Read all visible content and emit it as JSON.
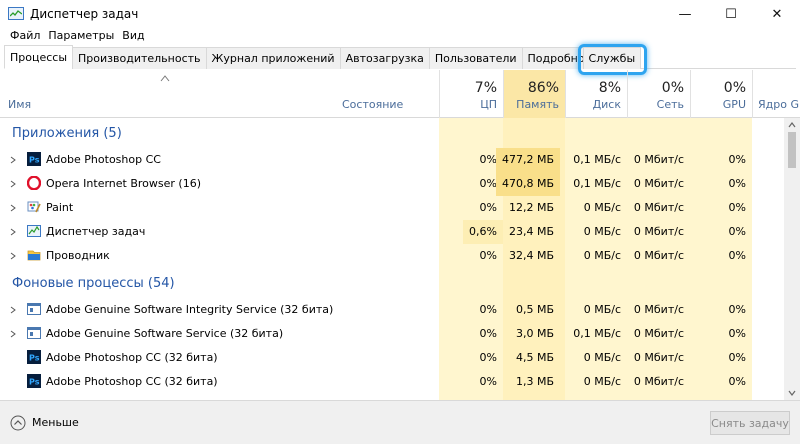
{
  "window": {
    "title": "Диспетчер задач",
    "minimize": "—",
    "maximize": "☐",
    "close": "✕"
  },
  "menu": [
    "Файл",
    "Параметры",
    "Вид"
  ],
  "tabs": [
    {
      "label": "Процессы",
      "active": true
    },
    {
      "label": "Производительность"
    },
    {
      "label": "Журнал приложений"
    },
    {
      "label": "Автозагрузка"
    },
    {
      "label": "Пользователи"
    },
    {
      "label": "Подробности"
    },
    {
      "label": "Службы",
      "highlighted": true
    }
  ],
  "columns": {
    "name": "Имя",
    "state": "Состояние",
    "cpu": {
      "pct": "7%",
      "label": "ЦП"
    },
    "mem": {
      "pct": "86%",
      "label": "Память"
    },
    "disk": {
      "pct": "8%",
      "label": "Диск"
    },
    "net": {
      "pct": "0%",
      "label": "Сеть"
    },
    "gpu": {
      "pct": "0%",
      "label": "GPU"
    },
    "gpu_engine": "Ядро GPU"
  },
  "groups": {
    "apps": "Приложения (5)",
    "background": "Фоновые процессы (54)"
  },
  "apps": [
    {
      "name": "Adobe Photoshop CC",
      "icon": "photoshop-icon",
      "cpu": "0%",
      "mem": "477,2 МБ",
      "disk": "0,1 МБ/с",
      "net": "0 Мбит/с",
      "gpu": "0%"
    },
    {
      "name": "Opera Internet Browser (16)",
      "icon": "opera-icon",
      "cpu": "0%",
      "mem": "470,8 МБ",
      "disk": "0,1 МБ/с",
      "net": "0 Мбит/с",
      "gpu": "0%"
    },
    {
      "name": "Paint",
      "icon": "paint-icon",
      "cpu": "0%",
      "mem": "12,2 МБ",
      "disk": "0 МБ/с",
      "net": "0 Мбит/с",
      "gpu": "0%"
    },
    {
      "name": "Диспетчер задач",
      "icon": "taskmgr-icon",
      "cpu": "0,6%",
      "mem": "23,4 МБ",
      "disk": "0 МБ/с",
      "net": "0 Мбит/с",
      "gpu": "0%"
    },
    {
      "name": "Проводник",
      "icon": "folder-icon",
      "cpu": "0%",
      "mem": "32,4 МБ",
      "disk": "0 МБ/с",
      "net": "0 Мбит/с",
      "gpu": "0%"
    }
  ],
  "background": [
    {
      "name": "Adobe Genuine Software Integrity Service (32 бита)",
      "icon": "service-icon",
      "expand": true,
      "cpu": "0%",
      "mem": "0,5 МБ",
      "disk": "0 МБ/с",
      "net": "0 Мбит/с",
      "gpu": "0%"
    },
    {
      "name": "Adobe Genuine Software Service (32 бита)",
      "icon": "service-icon",
      "expand": true,
      "cpu": "0%",
      "mem": "3,0 МБ",
      "disk": "0,1 МБ/с",
      "net": "0 Мбит/с",
      "gpu": "0%"
    },
    {
      "name": "Adobe Photoshop CC (32 бита)",
      "icon": "photoshop-icon",
      "expand": false,
      "cpu": "0%",
      "mem": "4,5 МБ",
      "disk": "0 МБ/с",
      "net": "0 Мбит/с",
      "gpu": "0%"
    },
    {
      "name": "Adobe Photoshop CC (32 бита)",
      "icon": "photoshop-icon",
      "expand": false,
      "cpu": "0%",
      "mem": "1,3 МБ",
      "disk": "0 МБ/с",
      "net": "0 Мбит/с",
      "gpu": "0%"
    }
  ],
  "footer": {
    "less": "Меньше",
    "end_task": "Снять задачу"
  },
  "colors": {
    "cpu_mem_bg": "#fff4c4",
    "mem_hot_bg": "#f9e08a",
    "light_bg": "#fff8dc",
    "group_text": "#2456a6",
    "highlight": "#2ea4ef"
  }
}
